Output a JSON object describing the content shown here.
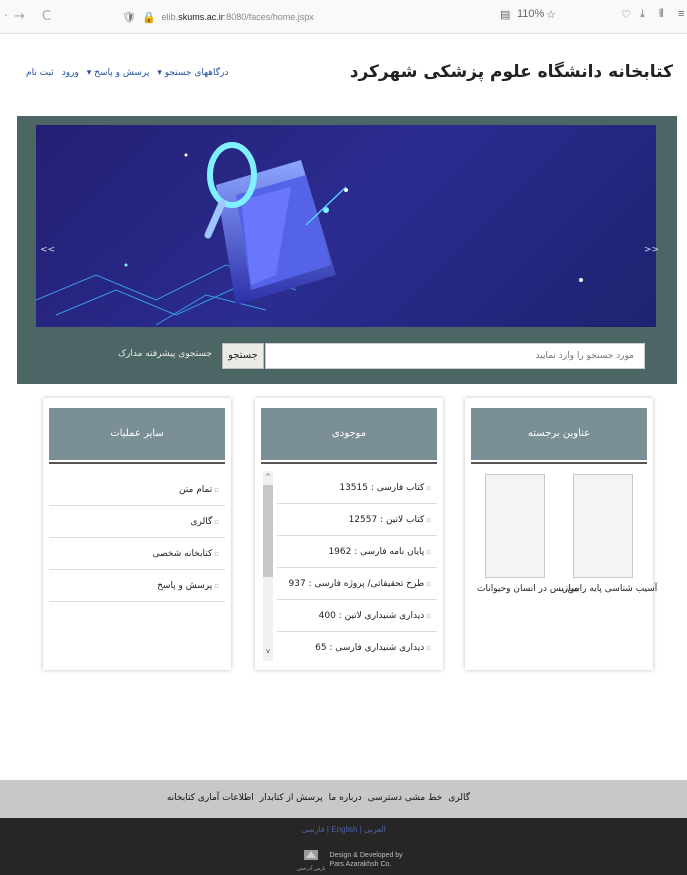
{
  "browser": {
    "url_protocol_host": "elib.",
    "url_host": "skums.ac.ir",
    "url_path": ":8080/faces/home.jspx",
    "zoom": "110%"
  },
  "header": {
    "title": "کتابخانه دانشگاه علوم پزشکی شهرکرد",
    "nav": [
      "درگاههای جستجو ▾",
      "پرسش و پاسخ ▾",
      "ورود",
      "ثبت نام"
    ]
  },
  "hero": {
    "prev_label": "<<",
    "next_label": ">>"
  },
  "search": {
    "placeholder": "مورد جستجو را وارد نمایید",
    "button_label": "جستجو",
    "advanced_label": "جستجوی پیشرفته مدارک"
  },
  "panels": {
    "featured": {
      "title": "عناوین برجسته",
      "books": [
        {
          "title": "آسیب شناسی پایه رابین..."
        },
        {
          "title": "میازیس در انسان وحیوانات"
        }
      ]
    },
    "inventory": {
      "title": "موجودی",
      "items": [
        "کتاب فارسی : 13515",
        "کتاب لاتین : 12557",
        "پایان نامه فارسی : 1962",
        "طرح تحقیقاتی/ پروژه فارسی : 937",
        "دیداری شنیداری لاتین : 400",
        "دیداری شنیداری فارسی : 65"
      ]
    },
    "other": {
      "title": "سایر عملیات",
      "items": [
        "تمام متن",
        "گالری",
        "کتابخانه شخصی",
        "پرسش و پاسخ"
      ]
    }
  },
  "footer": {
    "links": [
      "گالری",
      "خط مشی دسترسی",
      "درباره ما",
      "پرسش از کتابدار",
      "اطلاعات آماری کتابخانه"
    ],
    "languages": "فارسی | English | العربی",
    "credit_line1": "Design & Developed by",
    "credit_line2": "Pars Azarakhsh Co.",
    "logo_text": "پارس آذرخش"
  },
  "colors": {
    "hero_bg": "#4c6665",
    "banner": "#2a2c8f",
    "panel_header": "#7b8f97",
    "footer_light": "#c8c8c8",
    "footer_dark": "#262626",
    "nav_link": "#1f4f9e"
  }
}
